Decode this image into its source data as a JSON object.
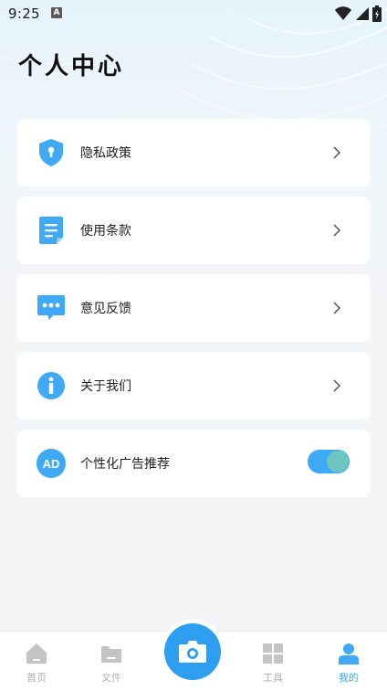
{
  "status_bar": {
    "time": "9:25",
    "notification_letter": "A"
  },
  "header": {
    "title": "个人中心"
  },
  "menu": {
    "items": [
      {
        "label": "隐私政策",
        "icon": "shield-keyhole-icon",
        "action": "chevron"
      },
      {
        "label": "使用条款",
        "icon": "document-icon",
        "action": "chevron"
      },
      {
        "label": "意见反馈",
        "icon": "chat-bubble-icon",
        "action": "chevron"
      },
      {
        "label": "关于我们",
        "icon": "info-icon",
        "action": "chevron"
      },
      {
        "label": "个性化广告推荐",
        "icon": "ad-icon",
        "badge_text": "AD",
        "action": "toggle",
        "toggle_on": true
      }
    ]
  },
  "tabbar": {
    "tabs": [
      {
        "label": "首页",
        "icon": "home-icon",
        "active": false
      },
      {
        "label": "文件",
        "icon": "folder-icon",
        "active": false
      },
      {
        "label": "工具",
        "icon": "grid-icon",
        "active": false
      },
      {
        "label": "我的",
        "icon": "user-icon",
        "active": true
      }
    ],
    "center_icon": "camera-icon"
  },
  "colors": {
    "accent": "#3fa9f5",
    "toggle_knob": "#6dc5c2",
    "inactive_tab": "#b0b0b0",
    "background": "#f4f5f7"
  }
}
